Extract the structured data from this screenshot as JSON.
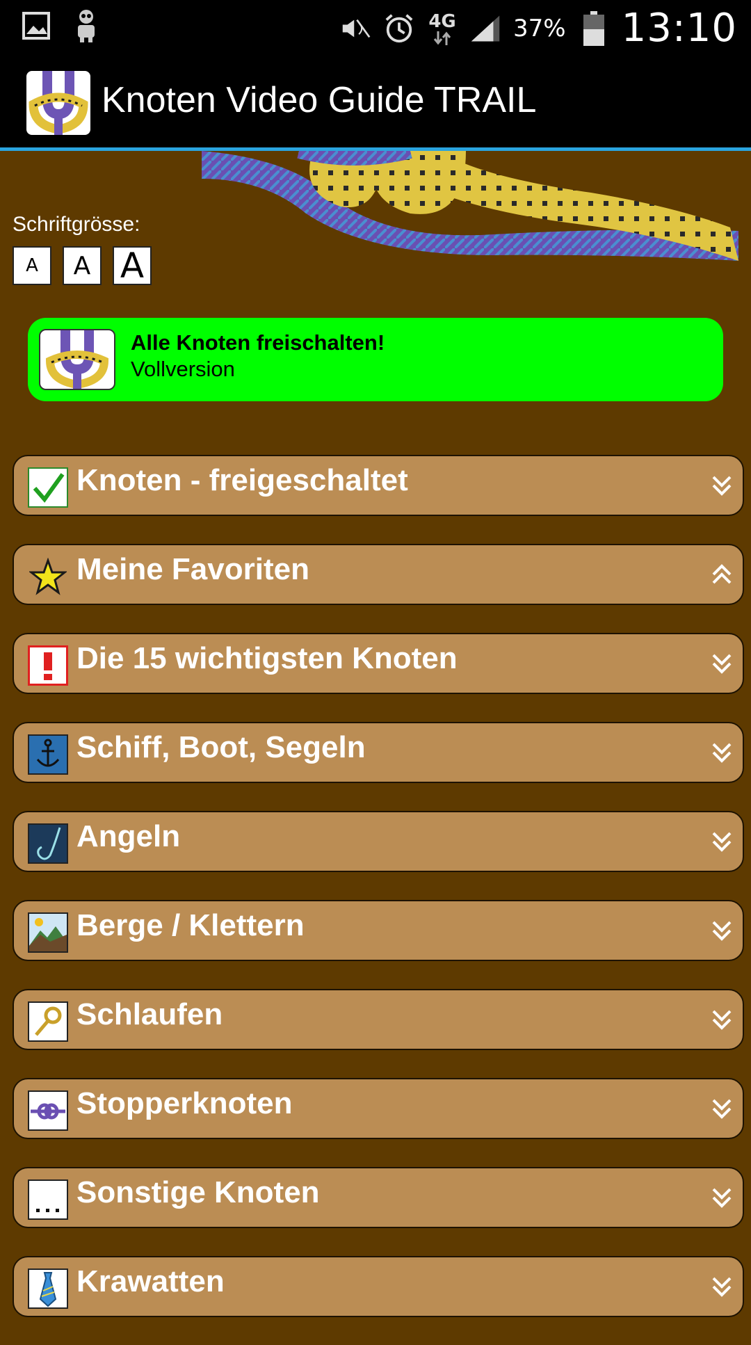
{
  "status_bar": {
    "battery_percent": "37%",
    "time": "13:10",
    "network": "4G",
    "icons": [
      "gallery-icon",
      "robot-icon",
      "mute-icon",
      "alarm-icon",
      "4g-icon",
      "signal-icon",
      "battery-icon"
    ]
  },
  "app_bar": {
    "title": "Knoten Video Guide TRAIL",
    "logo_icon": "knot-logo-icon"
  },
  "font_size": {
    "label": "Schriftgrösse:",
    "buttons": [
      "A",
      "A",
      "A"
    ]
  },
  "promo": {
    "title": "Alle Knoten freischalten!",
    "subtitle": "Vollversion",
    "color": "#00ff00"
  },
  "categories": [
    {
      "label": "Knoten - freigeschaltet",
      "icon": "checkmark-icon",
      "expanded": false
    },
    {
      "label": "Meine Favoriten",
      "icon": "star-icon",
      "expanded": true
    },
    {
      "label": "Die 15 wichtigsten Knoten",
      "icon": "exclamation-icon",
      "expanded": false
    },
    {
      "label": "Schiff, Boot, Segeln",
      "icon": "anchor-icon",
      "expanded": false
    },
    {
      "label": "Angeln",
      "icon": "fishhook-icon",
      "expanded": false
    },
    {
      "label": "Berge / Klettern",
      "icon": "mountain-icon",
      "expanded": false
    },
    {
      "label": "Schlaufen",
      "icon": "loop-icon",
      "expanded": false
    },
    {
      "label": "Stopperknoten",
      "icon": "stopper-knot-icon",
      "expanded": false
    },
    {
      "label": "Sonstige Knoten",
      "icon": "ellipsis-icon",
      "expanded": false
    },
    {
      "label": "Krawatten",
      "icon": "tie-icon",
      "expanded": false
    }
  ],
  "colors": {
    "background": "#5e3a00",
    "category_fill": "#bb8d54",
    "app_bar": "#000000",
    "accent_line": "#2aa4df"
  }
}
